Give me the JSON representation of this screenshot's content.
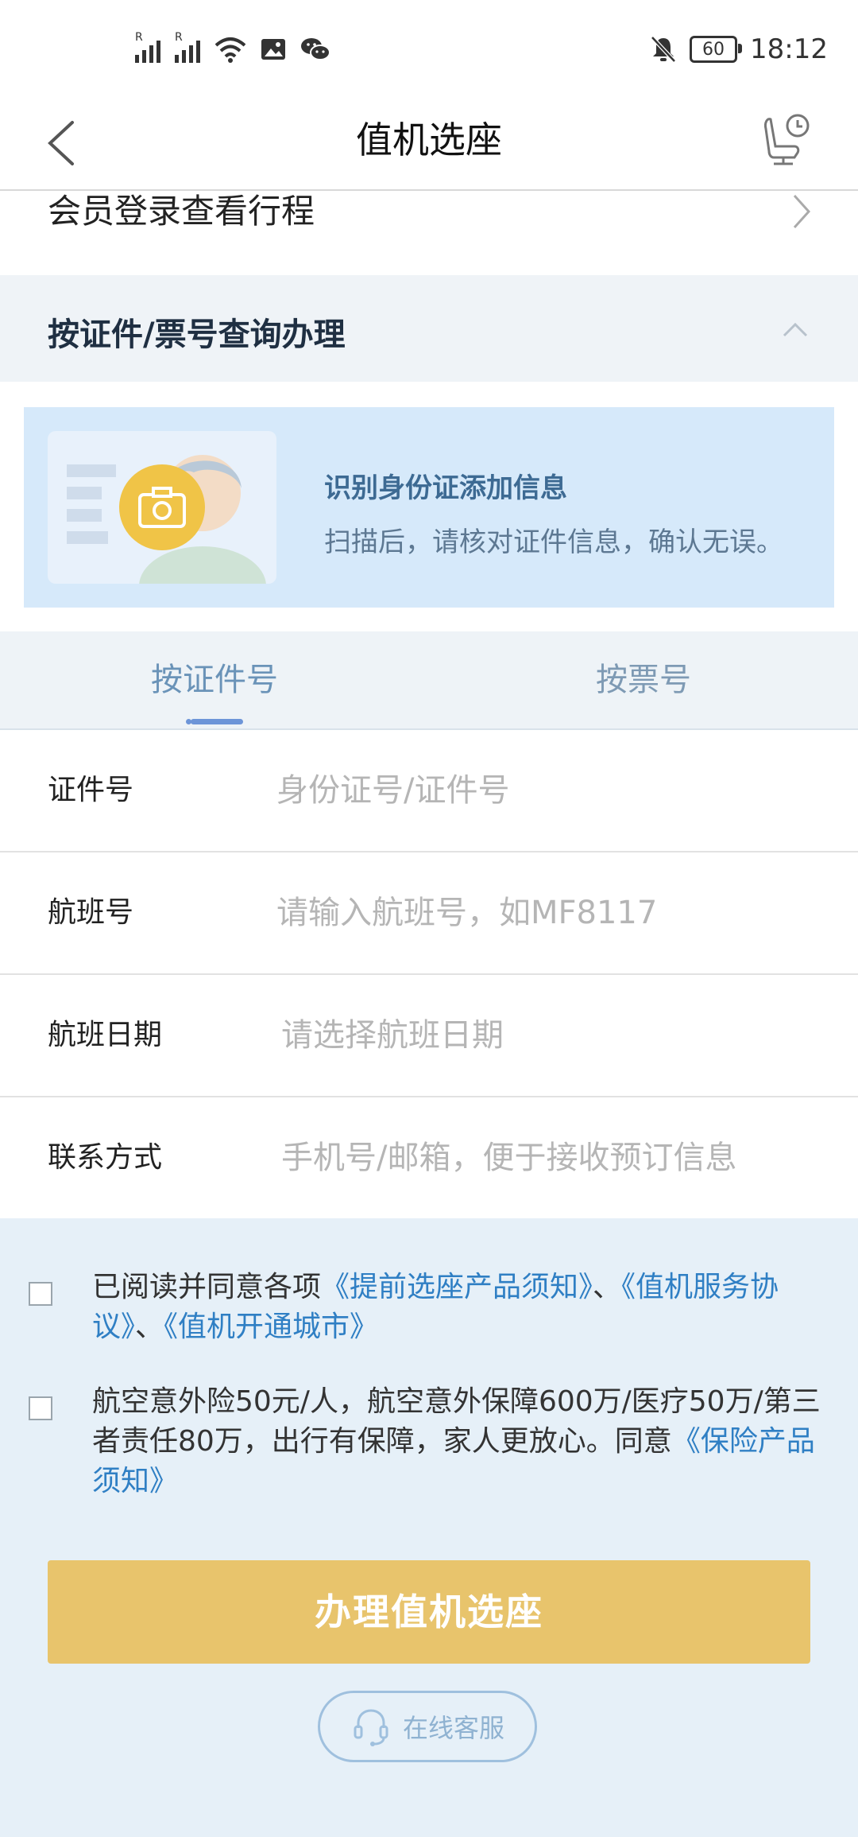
{
  "status_bar": {
    "time": "18:12",
    "battery": "60",
    "icons": [
      "signal-icon",
      "signal-icon",
      "wifi-icon",
      "image-notification-icon",
      "wechat-icon",
      "mute-icon",
      "battery-icon"
    ]
  },
  "header": {
    "title": "值机选座",
    "back_icon": "chevron-left-icon",
    "right_icon": "seat-history-icon"
  },
  "member": {
    "label": "会员登录查看行程"
  },
  "section": {
    "title": "按证件/票号查询办理"
  },
  "scan": {
    "title": "识别身份证添加信息",
    "subtitle": "扫描后，请核对证件信息，确认无误。"
  },
  "tabs": [
    {
      "label": "按证件号",
      "active": true
    },
    {
      "label": "按票号",
      "active": false
    }
  ],
  "form": {
    "fields": [
      {
        "label": "证件号",
        "placeholder": "身份证号/证件号",
        "value": ""
      },
      {
        "label": "航班号",
        "placeholder": "请输入航班号，如MF8117",
        "value": ""
      },
      {
        "label": "航班日期",
        "placeholder": "请选择航班日期",
        "value": ""
      },
      {
        "label": "联系方式",
        "placeholder": "手机号/邮箱，便于接收预订信息",
        "value": ""
      }
    ]
  },
  "agreements": {
    "first": {
      "prefix": "已阅读并同意各项",
      "link1": "《提前选座产品须知》",
      "sep1": "、",
      "link2": "《值机服务协议》",
      "sep2": "、",
      "link3": "《值机开通城市》",
      "checked": false
    },
    "second": {
      "text": "航空意外险50元/人，航空意外保障600万/医疗50万/第三者责任80万，出行有保障，家人更放心。同意",
      "link": "《保险产品须知》",
      "checked": false
    }
  },
  "submit": {
    "label": "办理值机选座"
  },
  "customer_service": {
    "label": "在线客服"
  },
  "colors": {
    "accent_button": "#e8c46c",
    "link": "#2f7fc4",
    "tab_active": "#6a93b8",
    "page_bg": "#e6f0f8"
  }
}
